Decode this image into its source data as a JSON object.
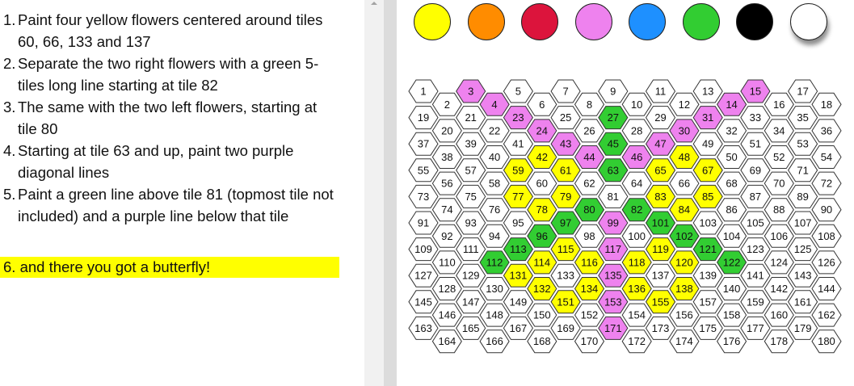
{
  "instructions": [
    {
      "num": "1.",
      "lines": [
        "Paint four yellow flowers centered around tiles",
        "60, 66, 133 and 137"
      ]
    },
    {
      "num": "2.",
      "lines": [
        "Separate the two right flowers with a green 5-",
        "tiles long line starting at tile 82"
      ]
    },
    {
      "num": "3.",
      "lines": [
        "The same with the two left flowers, starting at",
        "tile 80"
      ]
    },
    {
      "num": "4.",
      "lines": [
        "Starting at tile 63 and up, paint two purple",
        "diagonal lines"
      ]
    },
    {
      "num": "5.",
      "lines": [
        "Paint a green line above tile 81 (topmost tile not",
        "included) and a purple line below that tile"
      ]
    }
  ],
  "final_step": "6. and there you got a butterfly!",
  "palette": [
    {
      "name": "yellow",
      "color": "#ffff00"
    },
    {
      "name": "orange",
      "color": "#ff8c00"
    },
    {
      "name": "red",
      "color": "#dc143c"
    },
    {
      "name": "pink",
      "color": "#ee82ee"
    },
    {
      "name": "blue",
      "color": "#1e90ff"
    },
    {
      "name": "green",
      "color": "#32cd32"
    },
    {
      "name": "black",
      "color": "#000000"
    },
    {
      "name": "white",
      "color": "#ffffff",
      "selected": true
    }
  ],
  "board": {
    "columns": 18,
    "rows": 10,
    "colors": {
      "yellow": "#ffff00",
      "green": "#32cd32",
      "pink": "#ee82ee",
      "white": "#ffffff"
    },
    "painted": {
      "pink": [
        3,
        4,
        15,
        14,
        23,
        24,
        43,
        44,
        31,
        30,
        47,
        46,
        99,
        117,
        135,
        153,
        171
      ],
      "green": [
        27,
        45,
        63,
        80,
        82,
        97,
        101,
        96,
        102,
        113,
        121,
        112,
        122
      ],
      "yellow": [
        42,
        61,
        59,
        77,
        79,
        78,
        48,
        67,
        65,
        83,
        85,
        84,
        114,
        115,
        116,
        131,
        132,
        134,
        151,
        118,
        119,
        120,
        136,
        138,
        155
      ]
    }
  }
}
